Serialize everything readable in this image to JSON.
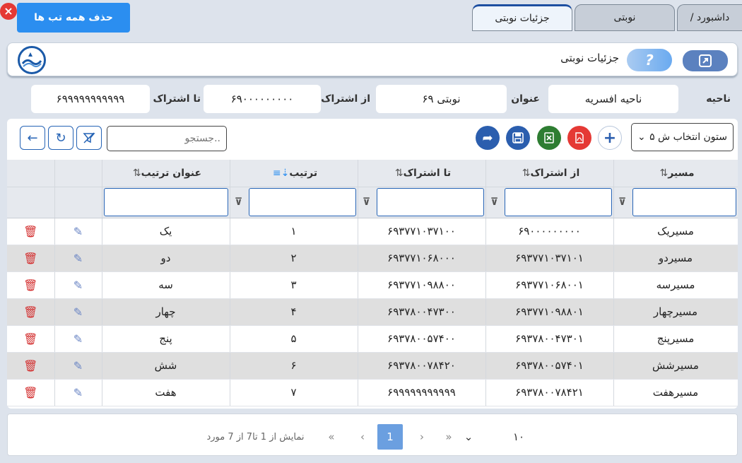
{
  "tabs": {
    "close_all_label": "حذف همه تب ها",
    "items": [
      {
        "label": "/ داشبورد"
      },
      {
        "label": "نوبتی"
      },
      {
        "label": "جزئیات نوبتی"
      }
    ]
  },
  "header": {
    "title": "جزئیات نوبتی",
    "help_label": "?"
  },
  "filters": {
    "region_label": "ناحیه",
    "region_value": "ناحیه افسریه",
    "title_label": "عنوان",
    "title_value": "نوبتی ۶۹",
    "from_label": "از اشتراک",
    "from_value": "۶۹۰۰۰۰۰۰۰۰۰",
    "to_label": "تا اشتراک",
    "to_value": "۶۹۹۹۹۹۹۹۹۹۹۹"
  },
  "toolbar": {
    "column_select_label": "۵ ستون انتخاب ش",
    "search_placeholder": "جستجو.."
  },
  "table": {
    "columns": [
      "مسیر",
      "از اشتراک",
      "تا اشتراک",
      "ترتیب",
      "عنوان ترتیب"
    ],
    "rows": [
      {
        "route": "مسیریک",
        "from": "۶۹۰۰۰۰۰۰۰۰۰",
        "to": "۶۹۳۷۷۱۰۳۷۱۰۰",
        "order": "۱",
        "order_title": "یک"
      },
      {
        "route": "مسیردو",
        "from": "۶۹۳۷۷۱۰۳۷۱۰۱",
        "to": "۶۹۳۷۷۱۰۶۸۰۰۰",
        "order": "۲",
        "order_title": "دو"
      },
      {
        "route": "مسیرسه",
        "from": "۶۹۳۷۷۱۰۶۸۰۰۱",
        "to": "۶۹۳۷۷۱۰۹۸۸۰۰",
        "order": "۳",
        "order_title": "سه"
      },
      {
        "route": "مسیرچهار",
        "from": "۶۹۳۷۷۱۰۹۸۸۰۱",
        "to": "۶۹۳۷۸۰۰۴۷۳۰۰",
        "order": "۴",
        "order_title": "چهار"
      },
      {
        "route": "مسیرپنج",
        "from": "۶۹۳۷۸۰۰۴۷۳۰۱",
        "to": "۶۹۳۷۸۰۰۵۷۴۰۰",
        "order": "۵",
        "order_title": "پنج"
      },
      {
        "route": "مسیرشش",
        "from": "۶۹۳۷۸۰۰۵۷۴۰۱",
        "to": "۶۹۳۷۸۰۰۷۸۴۲۰",
        "order": "۶",
        "order_title": "شش"
      },
      {
        "route": "مسیرهفت",
        "from": "۶۹۳۷۸۰۰۷۸۴۲۱",
        "to": "۶۹۹۹۹۹۹۹۹۹۹۹",
        "order": "۷",
        "order_title": "هفت"
      }
    ]
  },
  "pager": {
    "page_size": "۱۰",
    "current_page": "1",
    "summary": "نمایش از 1 تا7 از 7 مورد"
  }
}
